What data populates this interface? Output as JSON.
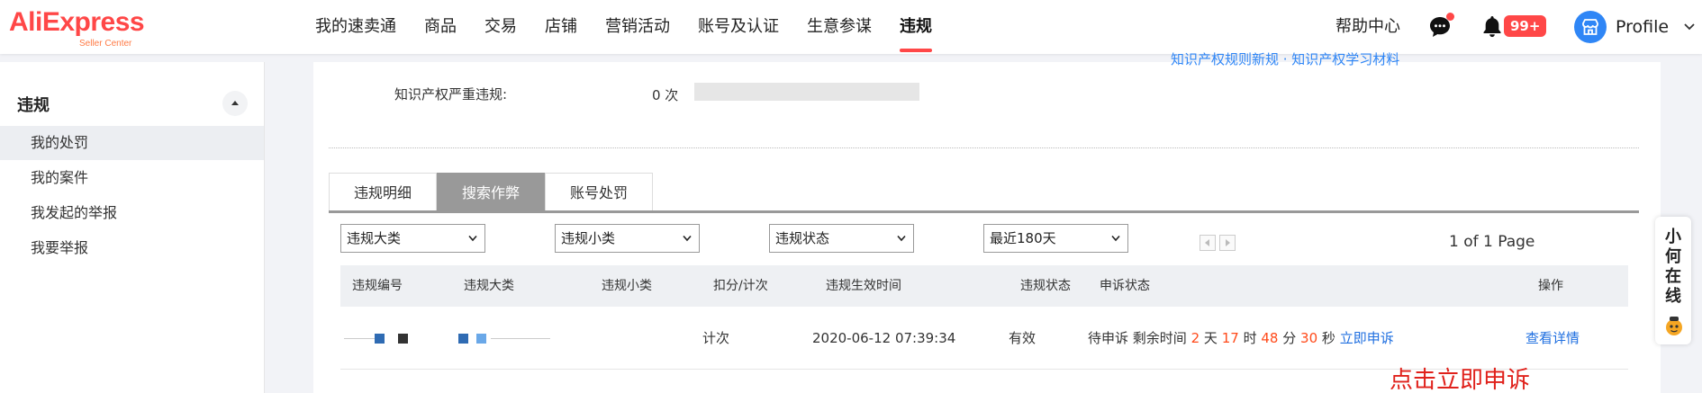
{
  "header": {
    "brand": "AliExpress",
    "brand_sub": "Seller Center",
    "nav": [
      "我的速卖通",
      "商品",
      "交易",
      "店铺",
      "营销活动",
      "账号及认证",
      "生意参谋",
      "违规"
    ],
    "active_nav": "违规",
    "help": "帮助中心",
    "notification_badge": "99+",
    "profile": "Profile"
  },
  "sidebar": {
    "title": "违规",
    "items": [
      "我的处罚",
      "我的案件",
      "我发起的举报",
      "我要举报"
    ],
    "active_item": "我的处罚"
  },
  "main": {
    "doc_links": "知识产权规则新规 · 知识产权学习材料",
    "ip_label": "知识产权严重违规:",
    "ip_count": "0 次",
    "tabs": [
      "违规明细",
      "搜索作弊",
      "账号处罚"
    ],
    "active_tab": "搜索作弊",
    "filters": [
      "违规大类",
      "违规小类",
      "违规状态",
      "最近180天"
    ],
    "page_info": "1 of 1 Page",
    "table": {
      "headers": [
        "违规编号",
        "违规大类",
        "违规小类",
        "扣分/计次",
        "违规生效时间",
        "违规状态",
        "申诉状态",
        "操作"
      ],
      "row": {
        "points": "计次",
        "effective_time": "2020-06-12 07:39:34",
        "status": "有效",
        "appeal_prefix": "待申诉 剩余时间",
        "days": "2",
        "days_unit": "天",
        "hours": "17",
        "hours_unit": "时",
        "minutes": "48",
        "minutes_unit": "分",
        "seconds": "30",
        "seconds_unit": "秒",
        "appeal_link": "立即申诉",
        "action": "查看详情"
      }
    },
    "annotation": "点击立即申诉"
  },
  "float_help": [
    "小",
    "何",
    "在",
    "线"
  ],
  "colors": {
    "brand": "#ff4747",
    "link": "#1f6fe0",
    "countdown": "#ff4a1a",
    "annotation": "#e0211b"
  }
}
